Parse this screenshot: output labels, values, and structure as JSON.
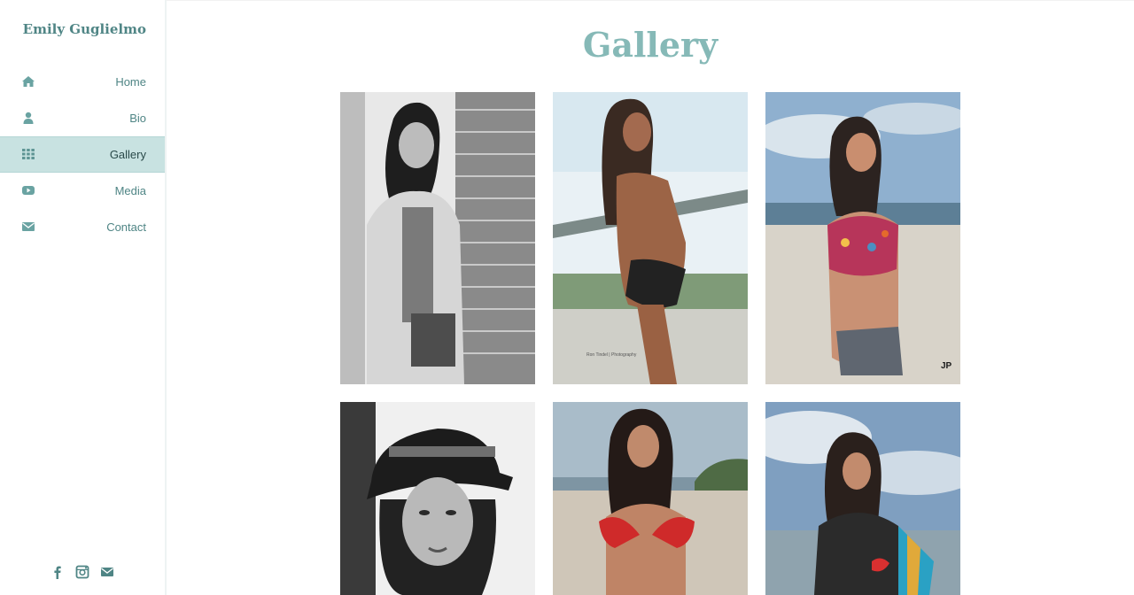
{
  "site": {
    "brand": "Emily Guglielmo"
  },
  "nav": [
    {
      "label": "Home",
      "icon": "home-icon",
      "active": false
    },
    {
      "label": "Bio",
      "icon": "user-icon",
      "active": false
    },
    {
      "label": "Gallery",
      "icon": "grid-icon",
      "active": true
    },
    {
      "label": "Media",
      "icon": "youtube-play-icon",
      "active": false
    },
    {
      "label": "Contact",
      "icon": "envelope-icon",
      "active": false
    }
  ],
  "social": [
    "facebook-icon",
    "instagram-icon",
    "envelope-icon"
  ],
  "page": {
    "title": "Gallery"
  },
  "gallery": {
    "photos": [
      {
        "name": "photo-1",
        "style": "black-and-white"
      },
      {
        "name": "photo-2",
        "style": "color",
        "watermark": "Ron Tindel | Photography"
      },
      {
        "name": "photo-3",
        "style": "color",
        "watermark": "JP"
      },
      {
        "name": "photo-4",
        "style": "black-and-white"
      },
      {
        "name": "photo-5",
        "style": "color"
      },
      {
        "name": "photo-6",
        "style": "color"
      }
    ]
  },
  "colors": {
    "accent": "#86b9b7",
    "nav_text": "#4f8585",
    "active_bg": "#c8e2e1"
  }
}
